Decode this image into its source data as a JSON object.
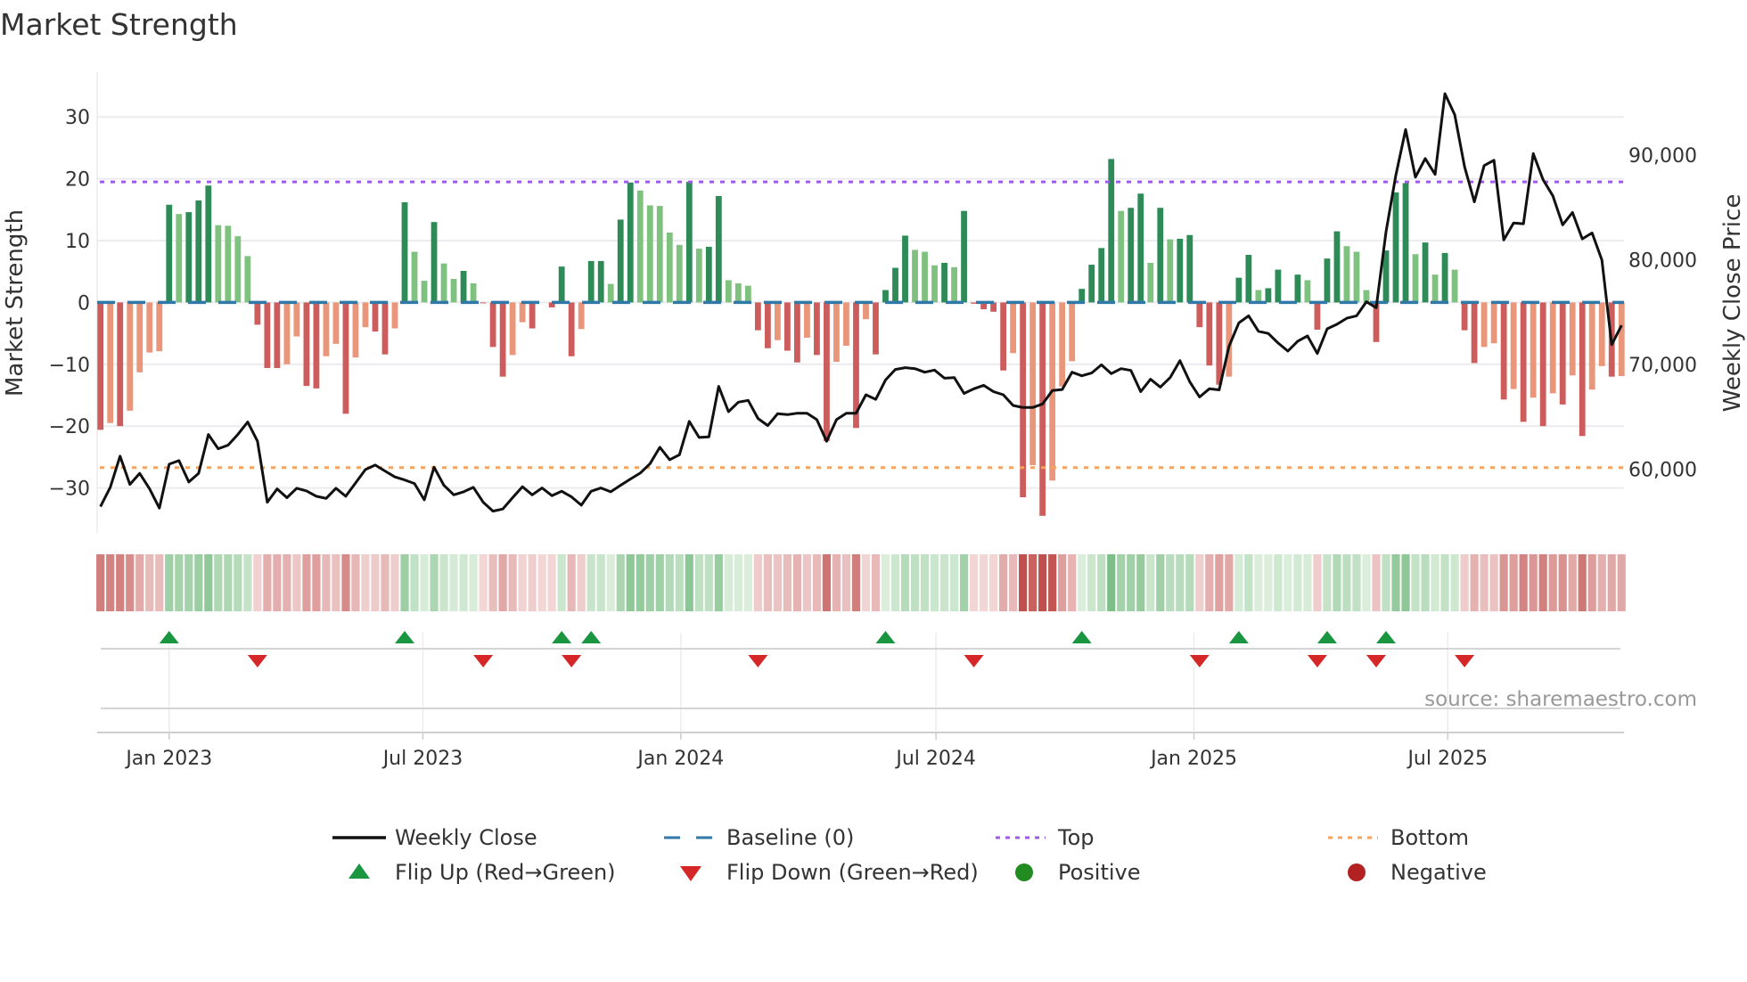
{
  "chart_data": {
    "type": "bar",
    "title": "Market Strength",
    "ylabel": "Market Strength",
    "ylabel_right": "Weekly Close Price",
    "ylim": [
      -37,
      39
    ],
    "ylim_right": [
      53500,
      98600
    ],
    "yticks": [
      {
        "value": 30,
        "label": "30"
      },
      {
        "value": 20,
        "label": "20"
      },
      {
        "value": 10,
        "label": "10"
      },
      {
        "value": 0,
        "label": "0"
      },
      {
        "value": -10,
        "label": "−10"
      },
      {
        "value": -20,
        "label": "−20"
      },
      {
        "value": -30,
        "label": "−30"
      }
    ],
    "yticks_right": [
      {
        "value": 90000,
        "label": "90,000"
      },
      {
        "value": 80000,
        "label": "80,000"
      },
      {
        "value": 70000,
        "label": "70,000"
      },
      {
        "value": 60000,
        "label": "60,000"
      }
    ],
    "x_start": "2022-11-13",
    "x_step_days": 7,
    "xticks": [
      {
        "date": "2023-01-01",
        "label": "Jan 2023"
      },
      {
        "date": "2023-07-01",
        "label": "Jul 2023"
      },
      {
        "date": "2024-01-01",
        "label": "Jan 2024"
      },
      {
        "date": "2024-07-01",
        "label": "Jul 2024"
      },
      {
        "date": "2025-01-01",
        "label": "Jan 2025"
      },
      {
        "date": "2025-07-01",
        "label": "Jul 2025"
      }
    ],
    "top_level": 19.5,
    "bottom_level": -26.7,
    "baseline": 0,
    "grid": true,
    "legend_position": "bottom",
    "series": [
      {
        "name": "Market Strength",
        "type": "bar",
        "values": [
          -20.6,
          -19.5,
          -20.0,
          -17.5,
          -11.3,
          -8.1,
          -7.9,
          15.8,
          14.3,
          14.6,
          16.5,
          18.9,
          12.5,
          12.4,
          10.7,
          7.5,
          -3.6,
          -10.6,
          -10.6,
          -10.0,
          -5.5,
          -13.5,
          -13.9,
          -8.7,
          -6.7,
          -18.0,
          -8.9,
          -4.0,
          -4.7,
          -8.4,
          -4.2,
          16.2,
          8.2,
          3.5,
          13.0,
          6.3,
          3.8,
          5.1,
          3.1,
          -0.1,
          -7.2,
          -12.0,
          -8.5,
          -3.2,
          -4.2,
          0,
          -0.8,
          5.8,
          -8.7,
          -4.3,
          6.7,
          6.7,
          3.0,
          13.4,
          19.4,
          18.1,
          15.7,
          15.6,
          11.3,
          9.3,
          19.5,
          8.7,
          9.0,
          17.2,
          3.6,
          3.1,
          2.7,
          -4.5,
          -7.4,
          -6.1,
          -7.8,
          -9.7,
          -5.7,
          -8.5,
          -22.4,
          -9.6,
          -7.0,
          -20.3,
          -2.7,
          -8.4,
          2.0,
          5.6,
          10.8,
          8.5,
          8.2,
          6.0,
          6.4,
          5.7,
          14.8,
          -0.2,
          -1.1,
          -1.5,
          -11.0,
          -8.2,
          -31.5,
          -26.3,
          -34.5,
          -28.8,
          -13.6,
          -9.5,
          2.2,
          6.1,
          8.8,
          23.2,
          14.8,
          15.3,
          17.6,
          6.4,
          15.3,
          10.2,
          10.3,
          10.9,
          -4.0,
          -10.2,
          -13.3,
          -12.0,
          4.0,
          7.7,
          2.0,
          2.3,
          5.3,
          0.2,
          4.5,
          3.6,
          -4.4,
          7.1,
          11.5,
          9.1,
          8.2,
          2.0,
          -6.4,
          8.4,
          17.8,
          19.3,
          7.8,
          9.7,
          4.5,
          8.0,
          5.3,
          -4.5,
          -9.8,
          -7.2,
          -6.6,
          -15.7,
          -14.0,
          -19.3,
          -15.4,
          -20.0,
          -14.7,
          -16.5,
          -11.8,
          -21.6,
          -14.1,
          -10.3,
          -12.0,
          -11.9
        ]
      },
      {
        "name": "Weekly Close",
        "type": "line",
        "axis": "right",
        "values": [
          56400,
          58240,
          61220,
          58525,
          59575,
          58100,
          56255,
          60455,
          60795,
          58750,
          59575,
          63290,
          61930,
          62270,
          63290,
          64480,
          62640,
          56820,
          58100,
          57250,
          58155,
          57900,
          57390,
          57190,
          58155,
          57390,
          58670,
          59945,
          60370,
          59800,
          59235,
          58950,
          58610,
          57050,
          60170,
          58440,
          57530,
          57815,
          58240,
          56820,
          55970,
          56170,
          57250,
          58300,
          57530,
          58185,
          57450,
          57870,
          57330,
          56540,
          57870,
          58185,
          57815,
          58440,
          59035,
          59600,
          60510,
          62070,
          60880,
          61360,
          64540,
          63010,
          63065,
          67890,
          65475,
          66380,
          66555,
          64820,
          64140,
          65275,
          65190,
          65330,
          65330,
          64710,
          62640,
          64710,
          65330,
          65330,
          67090,
          66650,
          68500,
          69510,
          69680,
          69580,
          69240,
          69445,
          68670,
          68735,
          67220,
          67660,
          67995,
          67390,
          67085,
          66070,
          65870,
          65870,
          66210,
          67490,
          67590,
          69240,
          68900,
          69170,
          69950,
          69110,
          69580,
          69410,
          67390,
          68570,
          67825,
          68735,
          70350,
          68330,
          66880,
          67660,
          67555,
          71700,
          73960,
          74630,
          73150,
          72950,
          72040,
          71260,
          72210,
          72710,
          71030,
          73390,
          73820,
          74400,
          74630,
          75980,
          75410,
          82650,
          88050,
          92430,
          87880,
          89660,
          88150,
          95860,
          93840,
          88890,
          85520,
          88990,
          89500,
          81880,
          83500,
          83430,
          90130,
          87640,
          86090,
          83330,
          84510,
          81980,
          82550,
          79960,
          71870,
          73720
        ]
      }
    ],
    "legend": [
      {
        "label": "Weekly Close",
        "kind": "line"
      },
      {
        "label": "Baseline (0)",
        "kind": "dash"
      },
      {
        "label": "Top",
        "kind": "dot-top"
      },
      {
        "label": "Bottom",
        "kind": "dot-bottom"
      },
      {
        "label": "Flip Up (Red→Green)",
        "kind": "tri-up"
      },
      {
        "label": "Flip Down (Green→Red)",
        "kind": "tri-down"
      },
      {
        "label": "Positive",
        "kind": "dot-pos"
      },
      {
        "label": "Negative",
        "kind": "dot-neg"
      }
    ],
    "colors": {
      "pos_strong": "#2e8b57",
      "pos_weak": "#7fc17f",
      "neg_strong": "#cd5c5c",
      "neg_weak": "#e9967a",
      "baseline": "#2f78a8",
      "top": "#9b5de5",
      "bottom": "#f4a460",
      "line": "#111111",
      "flip_up": "#1a9641",
      "flip_down": "#d62728",
      "positive": "#228b22",
      "negative": "#b22222"
    }
  },
  "source_note": "source: sharemaestro.com"
}
